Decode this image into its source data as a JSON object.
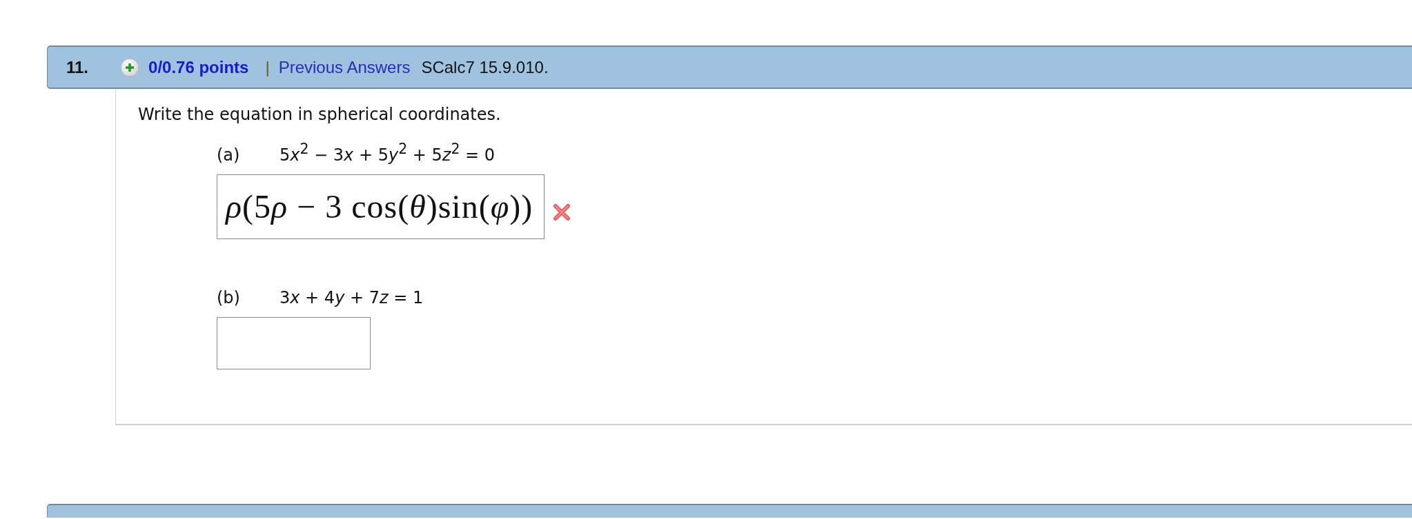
{
  "question": {
    "number": "11.",
    "points": "0/0.76 points",
    "separator": "|",
    "link": "Previous Answers",
    "source": "SCalc7 15.9.010."
  },
  "prompt": "Write the equation in spherical coordinates.",
  "parts": [
    {
      "label": "(a)",
      "equation": [
        "5",
        "*x*$^{2}$",
        " − 3",
        "*x*",
        " + 5",
        "*y*$^{2}$",
        " + 5",
        "*z*$^{2}$",
        " = 0"
      ],
      "answer": [
        "*ρ*(5",
        "*ρ*",
        " − 3 cos(*θ*)sin(*φ*))"
      ],
      "answered": true,
      "correct": false
    },
    {
      "label": "(b)",
      "equation": [
        "3",
        "*x*",
        " + 4",
        "*y*",
        " + 7",
        "*z*",
        " = 1"
      ],
      "answered": false
    }
  ]
}
